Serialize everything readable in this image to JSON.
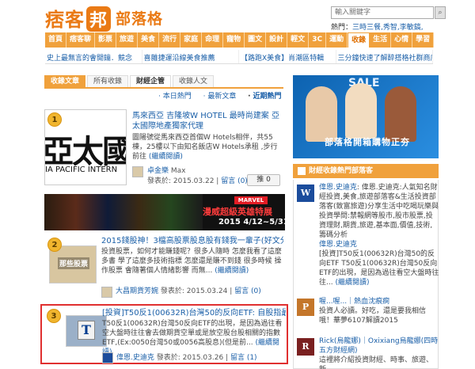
{
  "header": {
    "logo_text": "痞客",
    "logo_badge": "邦",
    "site_name": "部落格",
    "search_placeholder": "輸入關鍵字",
    "hot_label": "熱門：",
    "hot_keys": "三時三餐,秀智,李敏鎬,"
  },
  "nav": [
    {
      "label": "首頁",
      "active": false
    },
    {
      "label": "痞客聊",
      "active": false
    },
    {
      "label": "影票",
      "active": false
    },
    {
      "label": "旅遊",
      "active": false
    },
    {
      "label": "美食",
      "active": false
    },
    {
      "label": "流行",
      "active": false
    },
    {
      "label": "家庭",
      "active": false
    },
    {
      "label": "命理",
      "active": false
    },
    {
      "label": "寵物",
      "active": false
    },
    {
      "label": "圖文",
      "active": false
    },
    {
      "label": "設計",
      "active": false
    },
    {
      "label": "輕文",
      "active": false
    },
    {
      "label": "3C",
      "active": false
    },
    {
      "label": "運動",
      "active": false
    },
    {
      "label": "收錄",
      "active": true
    },
    {
      "label": "生活",
      "active": false
    },
    {
      "label": "心情",
      "active": false
    },
    {
      "label": "學習",
      "active": false
    }
  ],
  "ticker": [
    "史上最無言的會開鑰．競念",
    "喜雜捷運沿線美食推薦",
    "【路跑X美食】肖潮區特輯",
    "三分鐘快速了解醉搭格社群商店"
  ],
  "tabs": {
    "section": "收錄文章",
    "items": [
      "所有收錄",
      "財經企管",
      "收錄人文"
    ],
    "active_index": 1
  },
  "subtabs": {
    "items": [
      "本日熱門",
      "最新文章",
      "近期熱門"
    ],
    "active_index": 2
  },
  "articles": [
    {
      "rank": "1",
      "title": "馬來西亞 吉隆坡W HOTEL 最時尚建案 亞太國際地產獨家代理",
      "summary": "圖陽號從馬來西亞首個W Hotels相伴，共55棟，25樓以下由知名飯店W Hotels承租 ,步行前往",
      "more": "(繼續閱讀)",
      "thumb_big": "亞太國",
      "thumb_en": "IA PACIFIC INTERN",
      "author": "卓金樂",
      "author_sub": "Max",
      "date": "發表於: 2015.03.22",
      "comments": "留言 (0)",
      "push": "推 0"
    },
    {
      "rank": "2",
      "title": "2015錢股神！3檔高股票股息股有錢我一輩子(好文分享)",
      "summary": "投資股票，如何才能賺錢呢？很多人隨時 怎麼我看了這麼多書 學了這麼多技術指標 怎麼還是賺不到錢 很多時候 操作股票 會隨著個人情緒影響 而無...",
      "more": "(繼續閱讀)",
      "thumb_text": "那些股票",
      "author": "大昌期貨芳婉",
      "date": "發表於: 2015.03.24",
      "comments": "留言 (0)"
    },
    {
      "rank": "3",
      "title": "[投資]T50反1(00632R)台灣50的反向ETF: 自股指最大...",
      "summary": "T50反1(00632R)台灣50反向ETF的出現，是因為過往看空大盤時往往會去做期貨空單或是放空股台股相關的指數ETF,(Ex:0050台灣50或0056高股息)(但是前...",
      "more": "(繼續閱讀)",
      "thumb_letter": "T",
      "author": "偉恩.史迪克",
      "date": "發表於: 2015.03.26",
      "comments": "留言 (1)"
    }
  ],
  "banner": {
    "tag": "MARVEL",
    "headline": "漫威超級英雄特展",
    "dates": "2015 4/12~5/31"
  },
  "right": {
    "ad_top_label": "SALE",
    "ad_caption": "部落格開箱購物正夯",
    "box_title": "財經收錄熱門部落客",
    "items": [
      {
        "icon": "W",
        "title": "偉恩.史迪克",
        "text": "偉恩.史迪克:人氣知名財經投資,美食,旅遊部落客&生活投資部落客(致富旅遊)分享生活中吃喝玩樂與投資學問:禁報網等股市,股市股票,投資理財,期貨,旅遊,基本面,價值,技術,籌碼分析",
        "author": "偉恩.史迪克",
        "snippet": "[投資]T50反1(00632R)台灣50的反向ETF T50反1(00632R)台灣50反向ETF的出現，是因為過往看空大盤時往往...",
        "more": "(繼續閱讀)"
      },
      {
        "icon": "P",
        "title": "喔...喔...｜熱血沈痕痾",
        "text": "投資人必讀。好吃，還是要我相信哦！華夢6107解讀2015",
        "author": "",
        "snippet": "",
        "more": ""
      },
      {
        "icon": "R",
        "title": "Rick(烏龍娜)｜Oxixiang烏龍娜(四時五方財經網)",
        "text": "這裡將介紹投資財經、時事、旅遊、新",
        "author": "",
        "snippet": "",
        "more": ""
      }
    ]
  }
}
